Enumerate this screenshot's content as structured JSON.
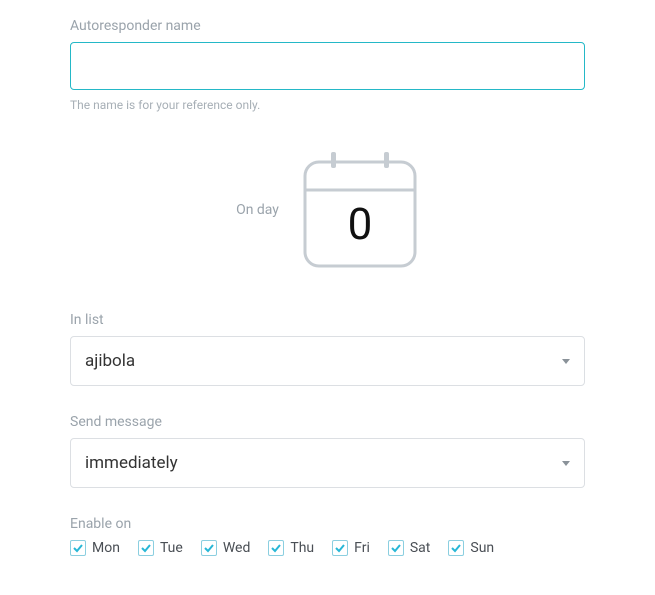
{
  "autoresponder": {
    "label": "Autoresponder name",
    "value": "",
    "help": "The name is for your reference only."
  },
  "onday": {
    "label": "On day",
    "value": "0"
  },
  "inlist": {
    "label": "In list",
    "selected": "ajibola"
  },
  "sendmessage": {
    "label": "Send message",
    "selected": "immediately"
  },
  "enableon": {
    "label": "Enable on",
    "days": [
      {
        "label": "Mon",
        "checked": true
      },
      {
        "label": "Tue",
        "checked": true
      },
      {
        "label": "Wed",
        "checked": true
      },
      {
        "label": "Thu",
        "checked": true
      },
      {
        "label": "Fri",
        "checked": true
      },
      {
        "label": "Sat",
        "checked": true
      },
      {
        "label": "Sun",
        "checked": true
      }
    ]
  },
  "colors": {
    "accent": "#24b8c7",
    "checkbox": "#27b7d6"
  }
}
